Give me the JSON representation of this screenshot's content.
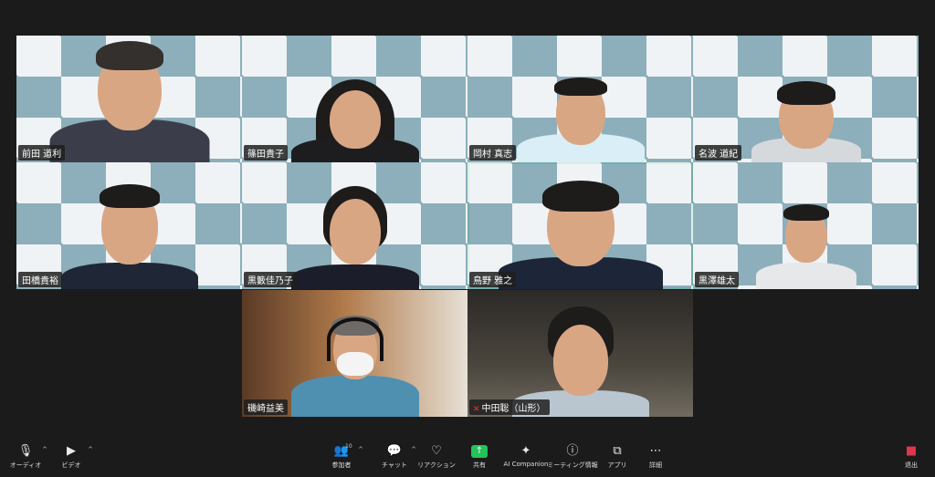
{
  "participants": [
    {
      "name": "前田 道利"
    },
    {
      "name": "篠田貴子"
    },
    {
      "name": "岡村 真志"
    },
    {
      "name": "名波 道紀"
    },
    {
      "name": "田橋貴裕"
    },
    {
      "name": "黒籔佳乃子"
    },
    {
      "name": "鳥野 雅之"
    },
    {
      "name": "黒澤雄太"
    },
    {
      "name": "磯崎益美"
    },
    {
      "name": "中田聡（山形）"
    }
  ],
  "toolbar": {
    "audio": "オーディオ",
    "video": "ビデオ",
    "participants": "参加者",
    "participants_count": "10",
    "chat": "チャット",
    "reactions": "リアクション",
    "share": "共有",
    "ai": "AI Companion",
    "info": "ミーティング情報",
    "apps": "アプリ",
    "more": "詳細",
    "leave": "退出"
  },
  "colors": {
    "speaker_border": "#3ccf6b",
    "share_green": "#23c45a",
    "leave_red": "#e0364b"
  }
}
